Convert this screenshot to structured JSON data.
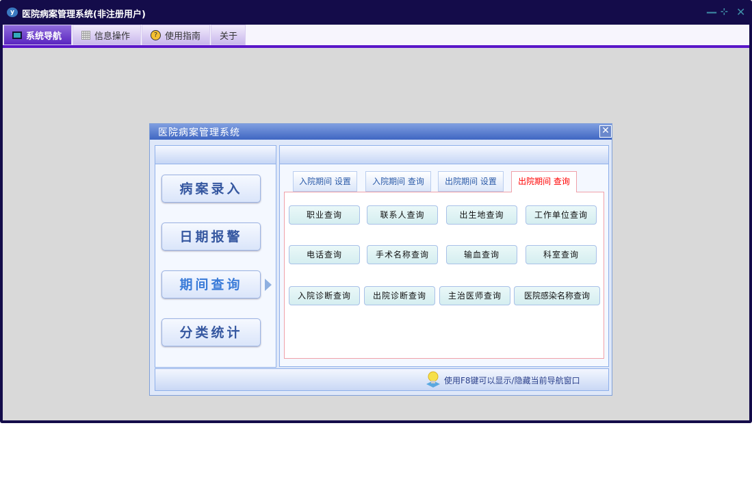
{
  "window": {
    "title": "医院病案管理系统(非注册用户)",
    "icon": "app-logo-icon",
    "controls": [
      "minimize-icon",
      "restore-icon",
      "close-icon"
    ]
  },
  "menu": [
    {
      "label": "系统导航",
      "icon": "monitor-icon",
      "active": true
    },
    {
      "label": "信息操作",
      "icon": "grid-icon"
    },
    {
      "label": "使用指南",
      "icon": "help-icon"
    },
    {
      "label": "关于"
    }
  ],
  "dialog": {
    "title": "医院病案管理系统",
    "nav": [
      "病案录入",
      "日期报警",
      "期间查询",
      "分类统计"
    ],
    "selected_nav": "期间查询",
    "tabs": [
      "入院期间 设置",
      "入院期间 查询",
      "出院期间 设置",
      "出院期间 查询"
    ],
    "active_tab": "出院期间 查询",
    "buttons": [
      [
        "职业查询",
        "联系人查询",
        "出生地查询",
        "工作单位查询"
      ],
      [
        "电话查询",
        "手术名称查询",
        "输血查询",
        "科室查询"
      ],
      [
        "入院诊断查询",
        "出院诊断查询",
        "主治医师查询",
        "医院感染名称查询"
      ]
    ],
    "tip": "使用F8键可以显示/隐藏当前导航窗口"
  },
  "colors": {
    "frame": "#140c4a",
    "accent": "#5a16c8",
    "active_tab": "#ff0000"
  }
}
